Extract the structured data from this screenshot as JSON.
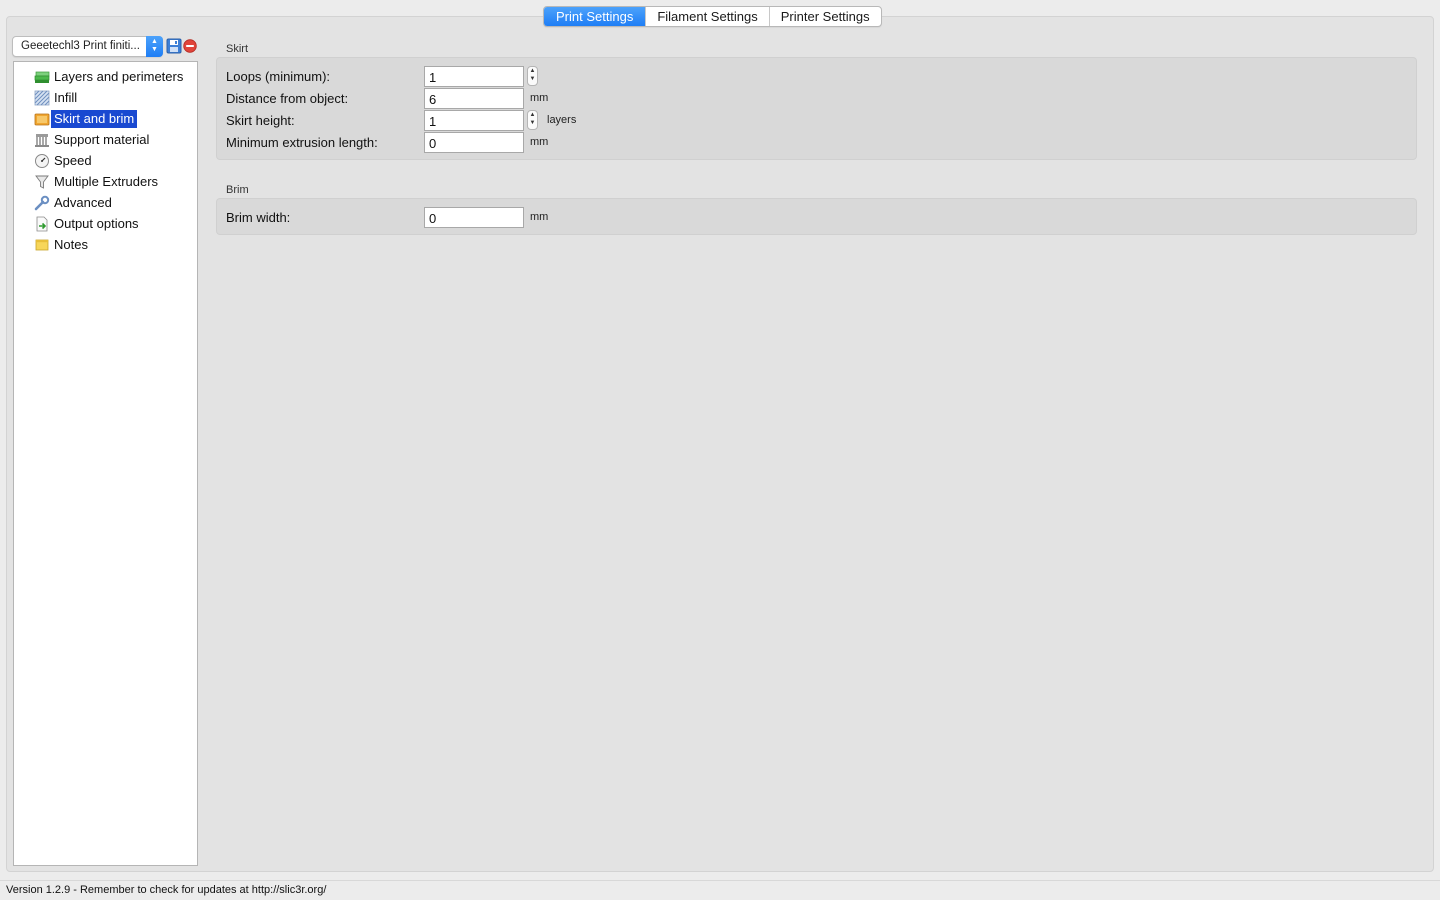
{
  "tabs": [
    {
      "label": "Print Settings",
      "active": true
    },
    {
      "label": "Filament Settings",
      "active": false
    },
    {
      "label": "Printer Settings",
      "active": false
    }
  ],
  "preset": {
    "selected": "Geeetechl3 Print finiti...",
    "save_icon": "save-icon",
    "delete_icon": "delete-icon"
  },
  "tree": {
    "items": [
      {
        "label": "Layers and perimeters",
        "icon": "layers-icon"
      },
      {
        "label": "Infill",
        "icon": "infill-icon"
      },
      {
        "label": "Skirt and brim",
        "icon": "skirt-icon",
        "selected": true
      },
      {
        "label": "Support material",
        "icon": "support-icon"
      },
      {
        "label": "Speed",
        "icon": "speed-icon"
      },
      {
        "label": "Multiple Extruders",
        "icon": "funnel-icon"
      },
      {
        "label": "Advanced",
        "icon": "wrench-icon"
      },
      {
        "label": "Output options",
        "icon": "output-icon"
      },
      {
        "label": "Notes",
        "icon": "notes-icon"
      }
    ]
  },
  "skirt": {
    "title": "Skirt",
    "loops": {
      "label": "Loops (minimum):",
      "value": "1"
    },
    "distance": {
      "label": "Distance from object:",
      "value": "6",
      "unit": "mm"
    },
    "height": {
      "label": "Skirt height:",
      "value": "1",
      "unit": "layers"
    },
    "min_extrusion": {
      "label": "Minimum extrusion length:",
      "value": "0",
      "unit": "mm"
    }
  },
  "brim": {
    "title": "Brim",
    "width": {
      "label": "Brim width:",
      "value": "0",
      "unit": "mm"
    }
  },
  "status": {
    "text": "Version 1.2.9 - Remember to check for updates at http://slic3r.org/"
  },
  "colors": {
    "accent": "#1f7ef5",
    "selection": "#1949d1",
    "panel": "#e3e3e3",
    "group": "#d9d9d9"
  }
}
